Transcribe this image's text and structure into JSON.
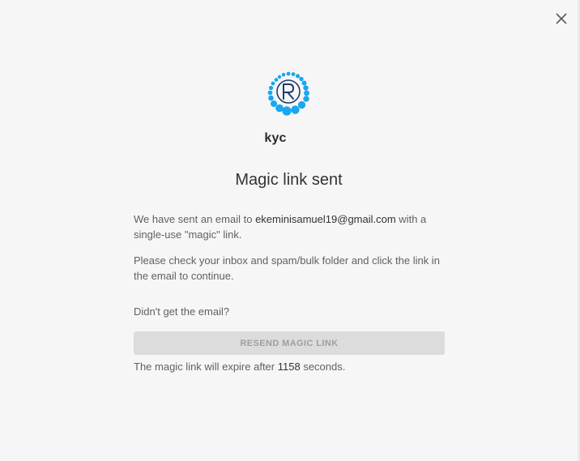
{
  "app": {
    "name": "kyc"
  },
  "dialog": {
    "title": "Magic link sent",
    "sent_prefix": "We have sent an email to ",
    "email": "ekeminisamuel19@gmail.com",
    "sent_suffix": " with a single-use \"magic\" link.",
    "instructions": "Please check your inbox and spam/bulk folder and click the link in the email to continue.",
    "didnt_get": "Didn't get the email?",
    "resend_label": "RESEND MAGIC LINK",
    "expire_prefix": "The magic link will expire after ",
    "expire_seconds": "1158",
    "expire_suffix": " seconds."
  },
  "icons": {
    "close": "close-icon",
    "logo": "logo-icon"
  },
  "colors": {
    "logo_blue": "#18a7f0",
    "logo_navy": "#1f3c6e",
    "background": "#f6f6f6",
    "button_disabled": "#dcdcdc"
  }
}
